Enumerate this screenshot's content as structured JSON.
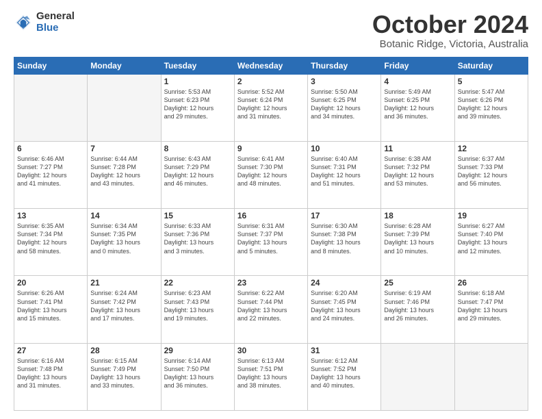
{
  "logo": {
    "general": "General",
    "blue": "Blue"
  },
  "title": {
    "month": "October 2024",
    "location": "Botanic Ridge, Victoria, Australia"
  },
  "days_header": [
    "Sunday",
    "Monday",
    "Tuesday",
    "Wednesday",
    "Thursday",
    "Friday",
    "Saturday"
  ],
  "weeks": [
    [
      {
        "day": "",
        "info": ""
      },
      {
        "day": "",
        "info": ""
      },
      {
        "day": "1",
        "info": "Sunrise: 5:53 AM\nSunset: 6:23 PM\nDaylight: 12 hours\nand 29 minutes."
      },
      {
        "day": "2",
        "info": "Sunrise: 5:52 AM\nSunset: 6:24 PM\nDaylight: 12 hours\nand 31 minutes."
      },
      {
        "day": "3",
        "info": "Sunrise: 5:50 AM\nSunset: 6:25 PM\nDaylight: 12 hours\nand 34 minutes."
      },
      {
        "day": "4",
        "info": "Sunrise: 5:49 AM\nSunset: 6:25 PM\nDaylight: 12 hours\nand 36 minutes."
      },
      {
        "day": "5",
        "info": "Sunrise: 5:47 AM\nSunset: 6:26 PM\nDaylight: 12 hours\nand 39 minutes."
      }
    ],
    [
      {
        "day": "6",
        "info": "Sunrise: 6:46 AM\nSunset: 7:27 PM\nDaylight: 12 hours\nand 41 minutes."
      },
      {
        "day": "7",
        "info": "Sunrise: 6:44 AM\nSunset: 7:28 PM\nDaylight: 12 hours\nand 43 minutes."
      },
      {
        "day": "8",
        "info": "Sunrise: 6:43 AM\nSunset: 7:29 PM\nDaylight: 12 hours\nand 46 minutes."
      },
      {
        "day": "9",
        "info": "Sunrise: 6:41 AM\nSunset: 7:30 PM\nDaylight: 12 hours\nand 48 minutes."
      },
      {
        "day": "10",
        "info": "Sunrise: 6:40 AM\nSunset: 7:31 PM\nDaylight: 12 hours\nand 51 minutes."
      },
      {
        "day": "11",
        "info": "Sunrise: 6:38 AM\nSunset: 7:32 PM\nDaylight: 12 hours\nand 53 minutes."
      },
      {
        "day": "12",
        "info": "Sunrise: 6:37 AM\nSunset: 7:33 PM\nDaylight: 12 hours\nand 56 minutes."
      }
    ],
    [
      {
        "day": "13",
        "info": "Sunrise: 6:35 AM\nSunset: 7:34 PM\nDaylight: 12 hours\nand 58 minutes."
      },
      {
        "day": "14",
        "info": "Sunrise: 6:34 AM\nSunset: 7:35 PM\nDaylight: 13 hours\nand 0 minutes."
      },
      {
        "day": "15",
        "info": "Sunrise: 6:33 AM\nSunset: 7:36 PM\nDaylight: 13 hours\nand 3 minutes."
      },
      {
        "day": "16",
        "info": "Sunrise: 6:31 AM\nSunset: 7:37 PM\nDaylight: 13 hours\nand 5 minutes."
      },
      {
        "day": "17",
        "info": "Sunrise: 6:30 AM\nSunset: 7:38 PM\nDaylight: 13 hours\nand 8 minutes."
      },
      {
        "day": "18",
        "info": "Sunrise: 6:28 AM\nSunset: 7:39 PM\nDaylight: 13 hours\nand 10 minutes."
      },
      {
        "day": "19",
        "info": "Sunrise: 6:27 AM\nSunset: 7:40 PM\nDaylight: 13 hours\nand 12 minutes."
      }
    ],
    [
      {
        "day": "20",
        "info": "Sunrise: 6:26 AM\nSunset: 7:41 PM\nDaylight: 13 hours\nand 15 minutes."
      },
      {
        "day": "21",
        "info": "Sunrise: 6:24 AM\nSunset: 7:42 PM\nDaylight: 13 hours\nand 17 minutes."
      },
      {
        "day": "22",
        "info": "Sunrise: 6:23 AM\nSunset: 7:43 PM\nDaylight: 13 hours\nand 19 minutes."
      },
      {
        "day": "23",
        "info": "Sunrise: 6:22 AM\nSunset: 7:44 PM\nDaylight: 13 hours\nand 22 minutes."
      },
      {
        "day": "24",
        "info": "Sunrise: 6:20 AM\nSunset: 7:45 PM\nDaylight: 13 hours\nand 24 minutes."
      },
      {
        "day": "25",
        "info": "Sunrise: 6:19 AM\nSunset: 7:46 PM\nDaylight: 13 hours\nand 26 minutes."
      },
      {
        "day": "26",
        "info": "Sunrise: 6:18 AM\nSunset: 7:47 PM\nDaylight: 13 hours\nand 29 minutes."
      }
    ],
    [
      {
        "day": "27",
        "info": "Sunrise: 6:16 AM\nSunset: 7:48 PM\nDaylight: 13 hours\nand 31 minutes."
      },
      {
        "day": "28",
        "info": "Sunrise: 6:15 AM\nSunset: 7:49 PM\nDaylight: 13 hours\nand 33 minutes."
      },
      {
        "day": "29",
        "info": "Sunrise: 6:14 AM\nSunset: 7:50 PM\nDaylight: 13 hours\nand 36 minutes."
      },
      {
        "day": "30",
        "info": "Sunrise: 6:13 AM\nSunset: 7:51 PM\nDaylight: 13 hours\nand 38 minutes."
      },
      {
        "day": "31",
        "info": "Sunrise: 6:12 AM\nSunset: 7:52 PM\nDaylight: 13 hours\nand 40 minutes."
      },
      {
        "day": "",
        "info": ""
      },
      {
        "day": "",
        "info": ""
      }
    ]
  ]
}
